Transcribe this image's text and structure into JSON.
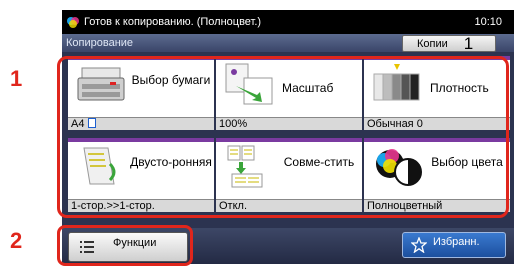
{
  "callouts": [
    "1",
    "2"
  ],
  "status_bar": {
    "text": "Готов к копированию. (Полноцвет.)",
    "time": "10:10"
  },
  "title_bar": {
    "title": "Копирование",
    "copies_label": "Копии",
    "copies_count": "1"
  },
  "tiles": [
    {
      "label": "Выбор бумаги",
      "value": "A4"
    },
    {
      "label": "Масштаб",
      "value": "100%"
    },
    {
      "label": "Плотность",
      "value": "Обычная 0"
    },
    {
      "label": "Двусто-ронняя",
      "value": "1-стор.>>1-стор."
    },
    {
      "label": "Совме-стить",
      "value": "Откл."
    },
    {
      "label": "Выбор цвета",
      "value": "Полноцветный"
    }
  ],
  "bottom_bar": {
    "functions_label": "Функции",
    "favorites_label": "Избранн."
  }
}
